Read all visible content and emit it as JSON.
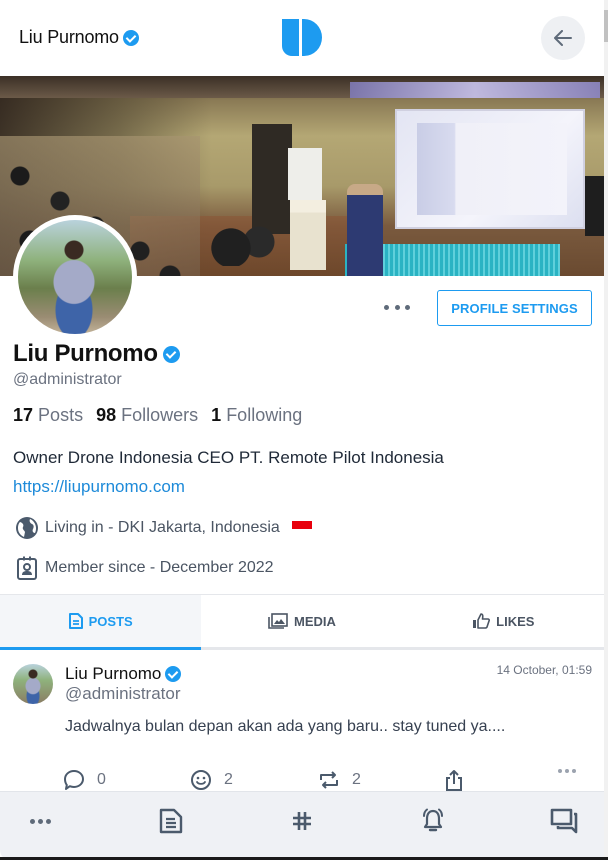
{
  "header": {
    "title": "Liu Purnomo",
    "verified": true,
    "logo_icon": "brand-logo-icon",
    "back_icon": "arrow-left-icon",
    "brand_color": "#1d9bf0"
  },
  "profile": {
    "name": "Liu Purnomo",
    "handle": "@administrator",
    "more_icon": "ellipsis-icon",
    "settings_label": "PROFILE SETTINGS",
    "stats": {
      "posts_count": "17",
      "posts_label": "Posts",
      "followers_count": "98",
      "followers_label": "Followers",
      "following_count": "1",
      "following_label": "Following"
    },
    "bio": "Owner Drone Indonesia CEO PT. Remote Pilot Indonesia",
    "website": "https://liupurnomo.com",
    "location": "Living in - DKI Jakarta, Indonesia",
    "location_icon": "globe-icon",
    "location_flag": "indonesia-flag",
    "member_since": "Member since - December 2022",
    "member_icon": "id-badge-icon"
  },
  "tabs": [
    {
      "label": "POSTS",
      "icon": "document-icon",
      "active": true
    },
    {
      "label": "MEDIA",
      "icon": "images-icon",
      "active": false
    },
    {
      "label": "LIKES",
      "icon": "thumbs-up-icon",
      "active": false
    }
  ],
  "post": {
    "author": "Liu Purnomo",
    "handle": "@administrator",
    "time": "14 October, 01:59",
    "text": "Jadwalnya bulan depan akan ada yang baru.. stay tuned ya....",
    "replies": "0",
    "reactions": "2",
    "reposts": "2"
  },
  "bottom_nav": [
    {
      "name": "more",
      "icon": "ellipsis-icon"
    },
    {
      "name": "posts",
      "icon": "document-icon"
    },
    {
      "name": "hashtags",
      "icon": "hashtag-icon"
    },
    {
      "name": "notifications",
      "icon": "bell-icon"
    },
    {
      "name": "messages",
      "icon": "chat-icon"
    }
  ]
}
